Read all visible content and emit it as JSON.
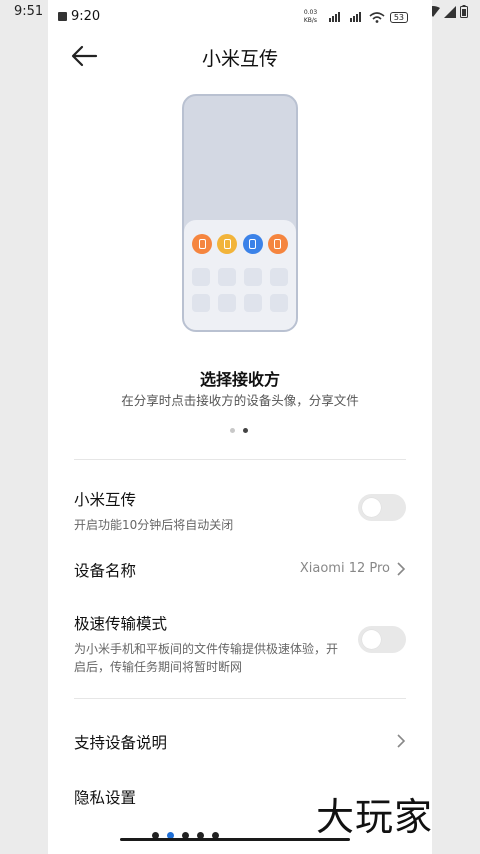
{
  "host_status": {
    "time": "9:51"
  },
  "status": {
    "time": "9:20",
    "speed": "0.03 KB/s",
    "battery": "53"
  },
  "header": {
    "title": "小米互传"
  },
  "intro": {
    "title": "选择接收方",
    "desc": "在分享时点击接收方的设备头像，分享文件",
    "page_index": 2,
    "page_count": 2,
    "avatar_colors": [
      "#f5853f",
      "#f2b43a",
      "#3b82e8",
      "#f5853f"
    ]
  },
  "settings": {
    "mi_share": {
      "title": "小米互传",
      "subtitle": "开启功能10分钟后将自动关闭",
      "enabled": false
    },
    "device_name": {
      "title": "设备名称",
      "value": "Xiaomi 12 Pro"
    },
    "fast_mode": {
      "title": "极速传输模式",
      "subtitle": "为小米手机和平板间的文件传输提供极速体验，开启后，传输任务期间将暂时断网",
      "enabled": false
    },
    "supported_devices": {
      "title": "支持设备说明"
    },
    "privacy": {
      "title": "隐私设置"
    }
  },
  "watermark": "大玩家"
}
